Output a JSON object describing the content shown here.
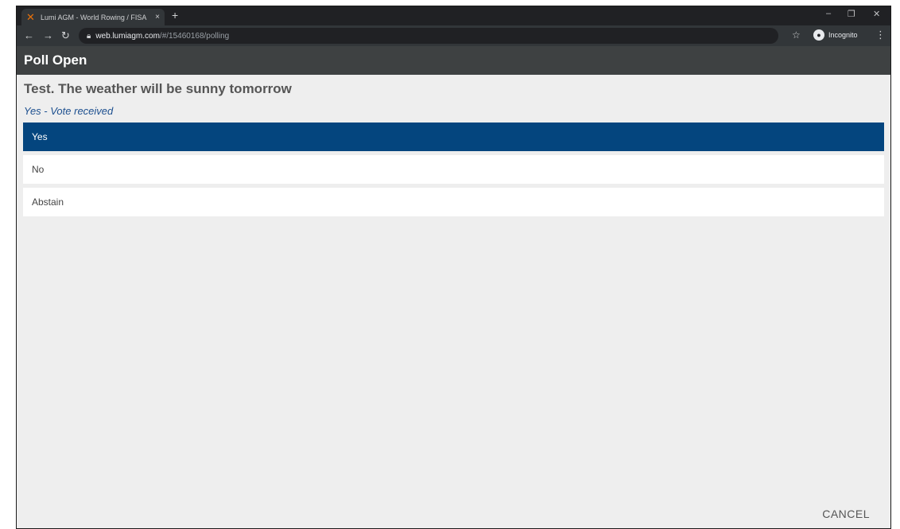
{
  "browser": {
    "tab_title": "Lumi AGM - World Rowing / FISA",
    "tab_close": "×",
    "new_tab": "+",
    "url_host": "web.lumiagm.com",
    "url_path": "/#/15460168/polling",
    "incognito_label": "Incognito"
  },
  "header": {
    "title": "Poll Open"
  },
  "poll": {
    "question": "Test. The weather will be sunny tomorrow",
    "status": "Yes - Vote received",
    "options": [
      {
        "label": "Yes",
        "selected": true
      },
      {
        "label": "No",
        "selected": false
      },
      {
        "label": "Abstain",
        "selected": false
      }
    ],
    "cancel_label": "CANCEL"
  },
  "colors": {
    "selected_option": "#04457e",
    "status_text": "#1c4f8f",
    "header_bg": "#3e4142"
  },
  "icons": [
    "lumi-logo-icon",
    "back-arrow-icon",
    "forward-arrow-icon",
    "reload-icon",
    "lock-icon",
    "star-icon",
    "incognito-icon",
    "more-vert-icon"
  ]
}
